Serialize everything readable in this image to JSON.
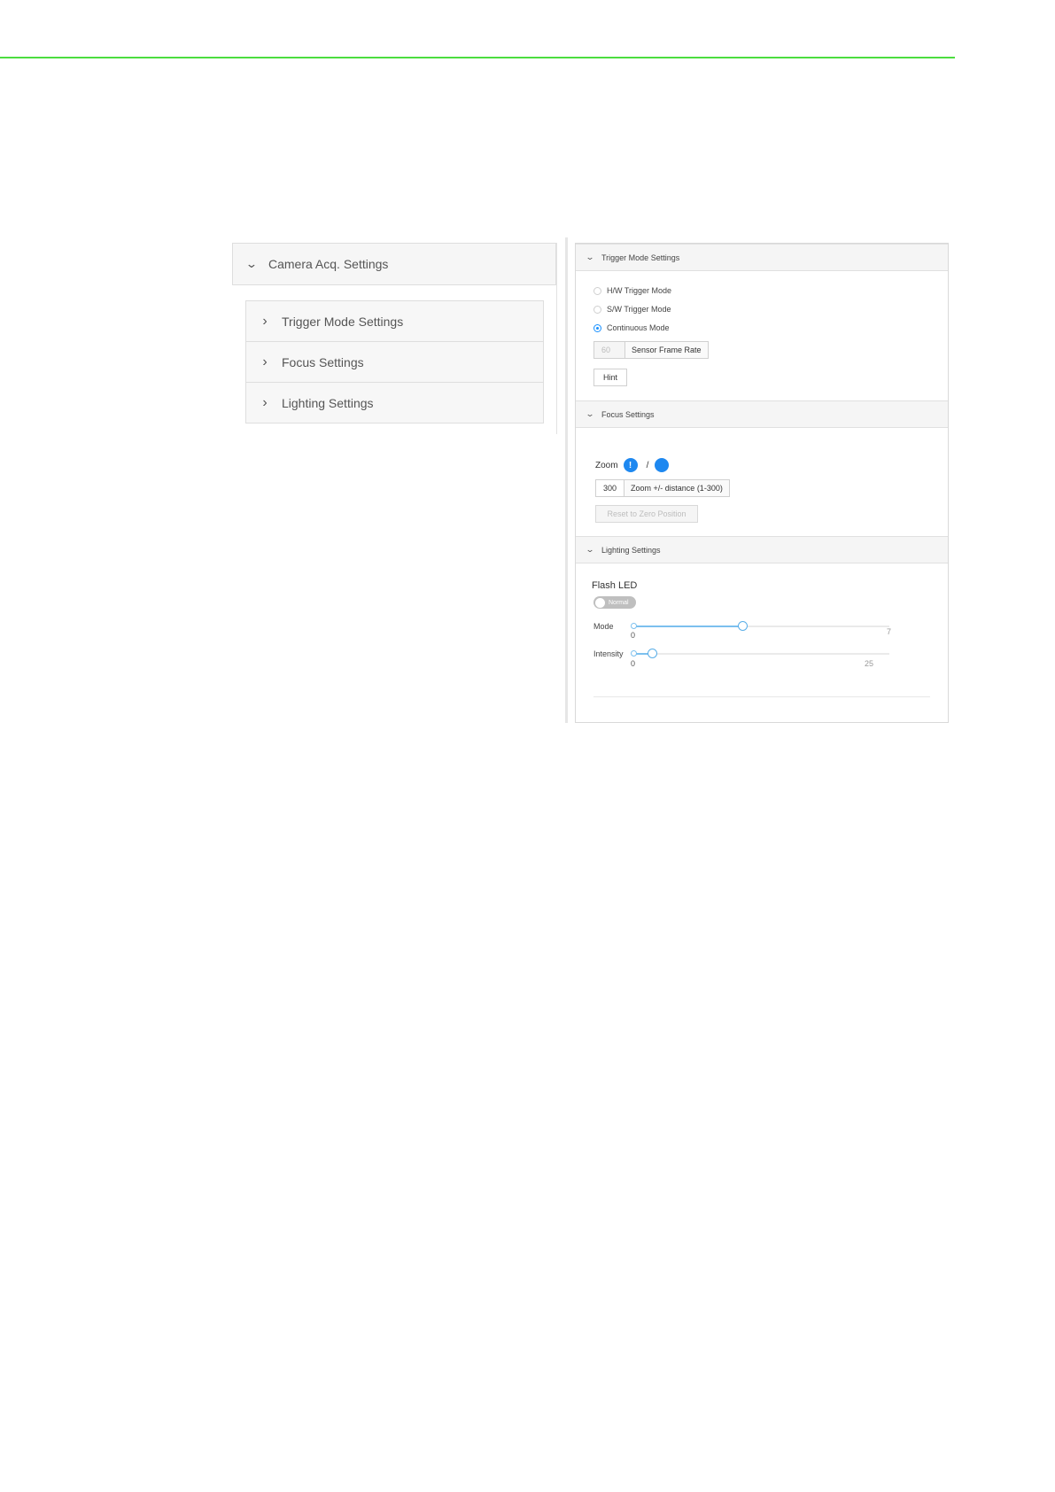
{
  "left": {
    "header": "Camera Acq. Settings",
    "items": [
      {
        "label": "Trigger Mode Settings"
      },
      {
        "label": "Focus Settings"
      },
      {
        "label": "Lighting Settings"
      }
    ]
  },
  "trigger": {
    "title": "Trigger Mode Settings",
    "options": [
      {
        "label": "H/W Trigger Mode",
        "selected": false
      },
      {
        "label": "S/W Trigger Mode",
        "selected": false
      },
      {
        "label": "Continuous Mode",
        "selected": true
      }
    ],
    "frame_rate_value": "60",
    "frame_rate_label": "Sensor Frame Rate",
    "hint_label": "Hint"
  },
  "focus": {
    "title": "Focus Settings",
    "zoom_label": "Zoom",
    "zoom_plus_symbol": "!",
    "zoom_separator": "/",
    "distance_value": "300",
    "distance_label": "Zoom +/- distance (1-300)",
    "reset_label": "Reset to Zero Position"
  },
  "lighting": {
    "title": "Lighting Settings",
    "flash_label": "Flash LED",
    "switch_text": "Normal",
    "switch_on": false,
    "mode": {
      "label": "Mode",
      "min": "0",
      "max": "7",
      "value": 3
    },
    "intensity": {
      "label": "Intensity",
      "min": "0",
      "max": "25",
      "value": 2
    }
  },
  "colors": {
    "accent": "#1890ff",
    "top_rule": "#4cdd3f",
    "slider_fill": "#7cc0ee"
  }
}
